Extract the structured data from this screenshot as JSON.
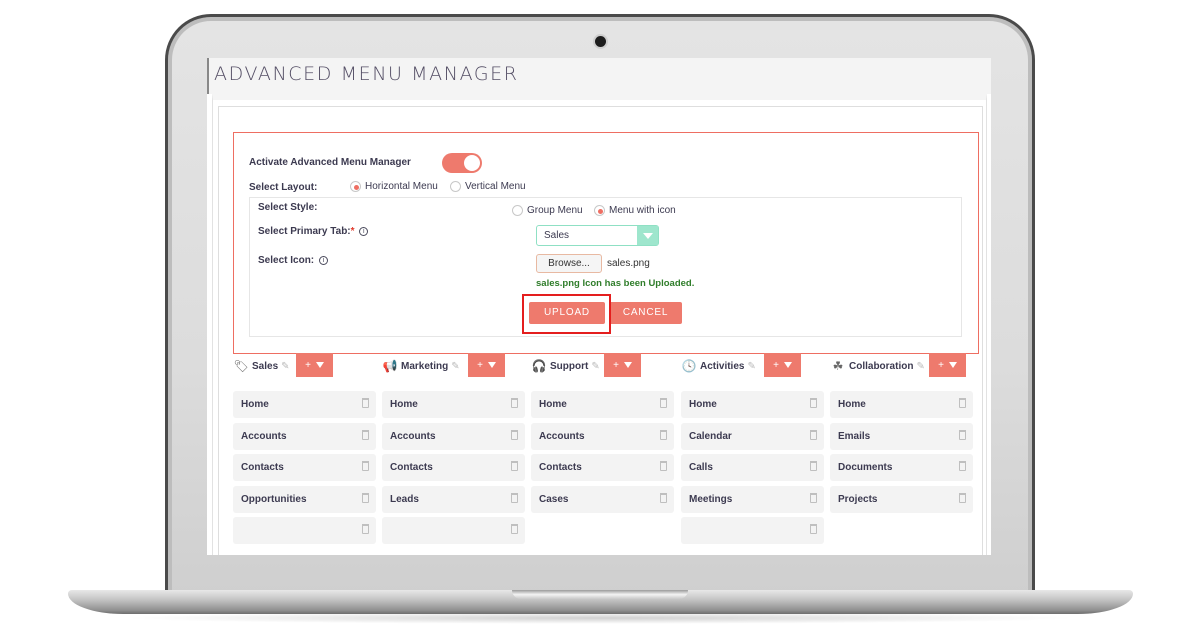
{
  "page": {
    "title": "ADVANCED MENU MANAGER"
  },
  "settings": {
    "activate_label": "Activate Advanced Menu Manager",
    "activate_on": true,
    "layout_label": "Select Layout:",
    "layout_options": [
      {
        "label": "Horizontal Menu",
        "selected": true
      },
      {
        "label": "Vertical Menu",
        "selected": false
      }
    ],
    "style_label": "Select Style:",
    "style_options": [
      {
        "label": "Group Menu",
        "selected": false
      },
      {
        "label": "Menu with icon",
        "selected": true
      }
    ],
    "primary_tab_label": "Select Primary Tab:",
    "primary_tab_required": "*",
    "primary_tab_value": "Sales",
    "icon_label": "Select Icon:",
    "info_glyph": "i",
    "browse_label": "Browse...",
    "file_name": "sales.png",
    "upload_message": "sales.png Icon has been Uploaded.",
    "upload_button": "UPLOAD",
    "cancel_button": "CANCEL"
  },
  "colors": {
    "accent": "#ee7a6d",
    "border_accent": "#ee6e62",
    "select_accent": "#9ee6cd",
    "success": "#2f7d2a",
    "highlight": "#e41e1e"
  },
  "add_button_label": "+",
  "groups": [
    {
      "name": "Sales",
      "icon": "tag-icon",
      "glyph": "🏷",
      "items": [
        "Home",
        "Accounts",
        "Contacts",
        "Opportunities",
        ""
      ]
    },
    {
      "name": "Marketing",
      "icon": "megaphone-icon",
      "glyph": "📢",
      "items": [
        "Home",
        "Accounts",
        "Contacts",
        "Leads",
        ""
      ]
    },
    {
      "name": "Support",
      "icon": "headset-icon",
      "glyph": "🎧",
      "items": [
        "Home",
        "Accounts",
        "Contacts",
        "Cases"
      ]
    },
    {
      "name": "Activities",
      "icon": "clock-icon",
      "glyph": "🕓",
      "items": [
        "Home",
        "Calendar",
        "Calls",
        "Meetings",
        ""
      ]
    },
    {
      "name": "Collaboration",
      "icon": "collaboration-icon",
      "glyph": "☘",
      "items": [
        "Home",
        "Emails",
        "Documents",
        "Projects"
      ]
    }
  ]
}
